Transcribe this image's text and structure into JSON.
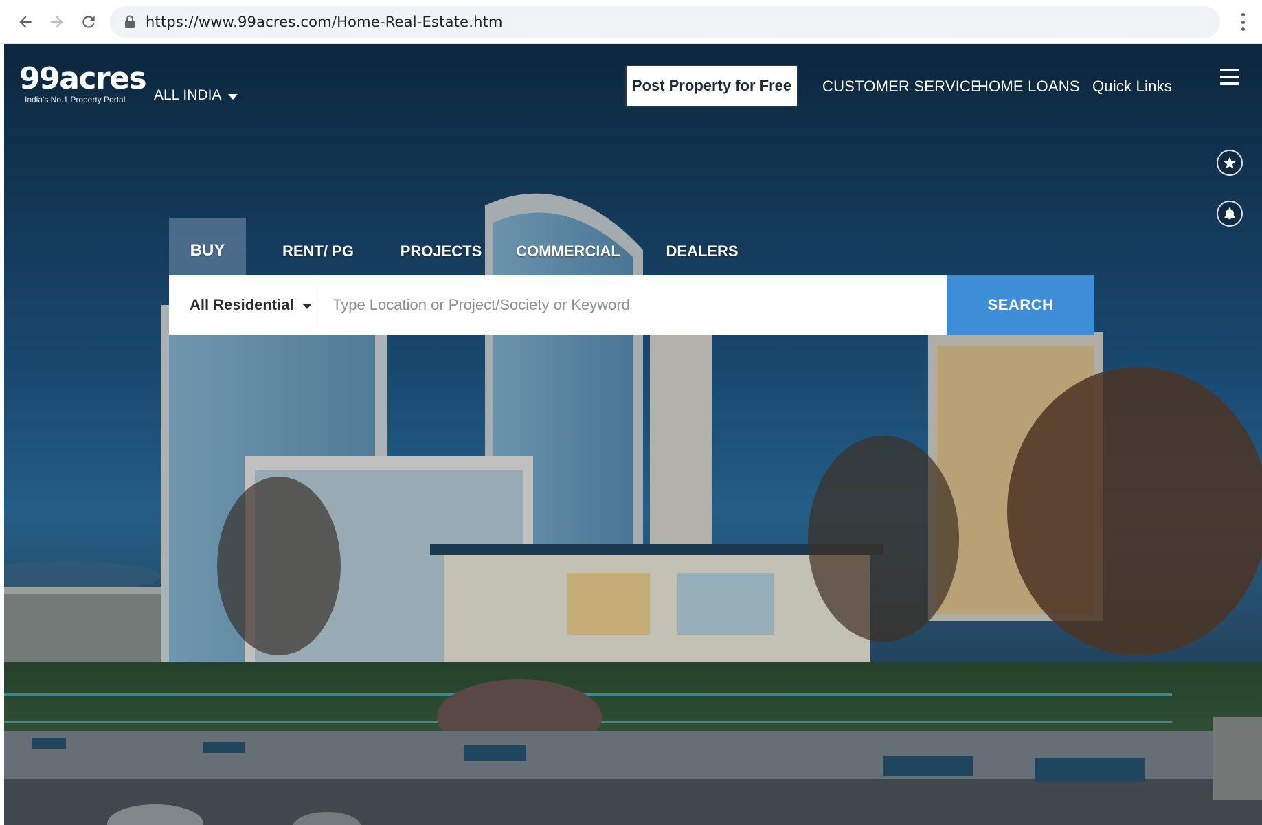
{
  "browser": {
    "url": "https://www.99acres.com/Home-Real-Estate.htm"
  },
  "header": {
    "logo_text": "99acres",
    "logo_tagline": "India's No.1 Property Portal",
    "region": "ALL INDIA",
    "post_property_label": "Post Property for Free",
    "links": [
      {
        "label": "CUSTOMER SERVICE"
      },
      {
        "label": "HOME LOANS"
      },
      {
        "label": "Quick Links"
      }
    ]
  },
  "search": {
    "tabs": [
      {
        "label": "BUY",
        "active": true
      },
      {
        "label": "RENT/ PG",
        "active": false
      },
      {
        "label": "PROJECTS",
        "active": false
      },
      {
        "label": "COMMERCIAL",
        "active": false
      },
      {
        "label": "DEALERS",
        "active": false
      }
    ],
    "category": "All Residential",
    "placeholder": "Type Location or Project/Society or Keyword",
    "button_label": "SEARCH"
  },
  "icons": {
    "back": "arrow-back-icon",
    "forward": "arrow-forward-icon",
    "reload": "reload-icon",
    "lock": "lock-icon",
    "browser_menu": "kebab-menu-icon",
    "site_menu": "hamburger-menu-icon",
    "shortlist": "star-icon",
    "notifications": "bell-icon"
  },
  "colors": {
    "search_button": "#3d8ed6",
    "active_tab": "#5a7896",
    "hero_sky": "#1f5784"
  }
}
